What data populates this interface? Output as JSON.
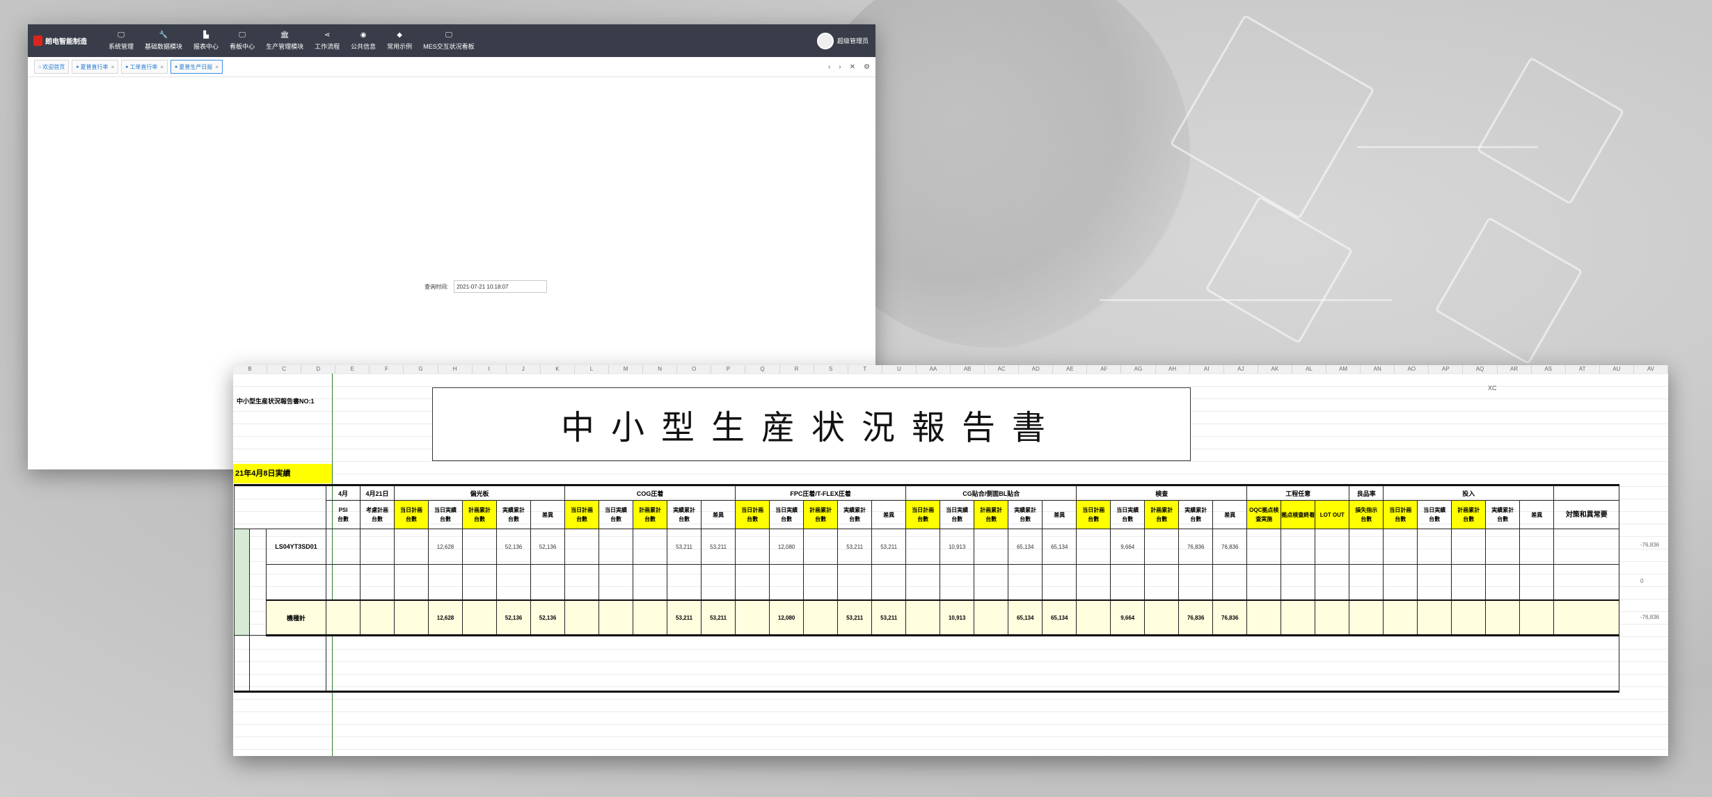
{
  "app": {
    "logo_text": "朗电智能制造",
    "nav": [
      {
        "icon": "monitor-icon",
        "glyph": "🖵",
        "label": "系统管理"
      },
      {
        "icon": "wrench-icon",
        "glyph": "🔧",
        "label": "基础数据模块"
      },
      {
        "icon": "chart-icon",
        "glyph": "▙",
        "label": "报表中心"
      },
      {
        "icon": "monitor-icon",
        "glyph": "🖵",
        "label": "看板中心"
      },
      {
        "icon": "bank-icon",
        "glyph": "🏛",
        "label": "生产管理模块"
      },
      {
        "icon": "share-icon",
        "glyph": "⋖",
        "label": "工作流程"
      },
      {
        "icon": "globe-icon",
        "glyph": "◉",
        "label": "公共信息"
      },
      {
        "icon": "tag-icon",
        "glyph": "◆",
        "label": "常用示例"
      },
      {
        "icon": "monitor-icon",
        "glyph": "🖵",
        "label": "MES交互状况看板"
      }
    ],
    "user_name": "超级管理员",
    "tabs": [
      {
        "label": "欢迎首页",
        "marker": "⌂",
        "closable": false,
        "active": false
      },
      {
        "label": "夏普直行率",
        "marker": "●",
        "closable": true,
        "active": false
      },
      {
        "label": "工单直行率",
        "marker": "●",
        "closable": true,
        "active": false
      },
      {
        "label": "夏普生产日报",
        "marker": "●",
        "closable": true,
        "active": true
      }
    ],
    "tab_tools": [
      "‹",
      "›",
      "✕",
      "⚙"
    ],
    "query_label": "查询时间:",
    "query_value": "2021-07-21 10:18:07"
  },
  "sheet": {
    "col_letters": [
      "B",
      "C",
      "D",
      "E",
      "F",
      "G",
      "H",
      "I",
      "J",
      "K",
      "L",
      "M",
      "N",
      "O",
      "P",
      "Q",
      "R",
      "S",
      "T",
      "U",
      "AA",
      "AB",
      "AC",
      "AD",
      "AE",
      "AF",
      "AG",
      "AH",
      "AI",
      "AJ",
      "AK",
      "AL",
      "AM",
      "AN",
      "AO",
      "AP",
      "AQ",
      "AR",
      "AS",
      "AT",
      "AU",
      "AV"
    ],
    "report_id": "中小型生産状況報告書NO:1",
    "title": "中小型生産状況報告書",
    "date_label": "21年4月8日実績",
    "xc": "XC",
    "group_headers": [
      "4月",
      "4月21日",
      "偏光板",
      "COG圧着",
      "FPC圧着/T-FLEX圧着",
      "CG貼合/側面BL貼合",
      "検査",
      "工程任意",
      "良品率",
      "投入"
    ],
    "sub_headers": [
      "PSI\n台數",
      "考慮計画\n台數",
      "当日計画\n台數",
      "当日実績\n台數",
      "計画累計\n台數",
      "実績累計\n台數",
      "差異",
      "当日計画\n台數",
      "当日実績\n台數",
      "計画累計\n台數",
      "実績累計\n台數",
      "差異",
      "当日計画\n台數",
      "当日実績\n台數",
      "計画累計\n台數",
      "実績累計\n台數",
      "差異",
      "当日計画\n台數",
      "当日実績\n台數",
      "計画累計\n台數",
      "実績累計\n台數",
      "差異",
      "当日計画\n台數",
      "当日実績\n台數",
      "計画累計\n台數",
      "実績累計\n台數",
      "差異",
      "OQC拠点検\n査実施",
      "拠点検査終着",
      "LOT OUT",
      "損失指示\n台數",
      "当日計画\n台數",
      "当日実績\n台數",
      "計画累計\n台數",
      "実績累計\n台數",
      "差異"
    ],
    "remark_header": "対策和異常要",
    "model": "LS04YT3SD01",
    "subtotal_label": "機種計",
    "row1": {
      "pol": [
        "",
        "12,628",
        "",
        "52,136",
        "52,136"
      ],
      "cog": [
        "",
        "",
        "",
        "53,211",
        "53,211"
      ],
      "fpc": [
        "",
        "12,080",
        "",
        "53,211",
        "53,211"
      ],
      "cg": [
        "",
        "10,913",
        "",
        "65,134",
        "65,134"
      ],
      "insp": [
        "",
        "9,664",
        "",
        "76,836",
        "76,836"
      ]
    },
    "totals": {
      "pol": [
        "",
        "12,628",
        "",
        "52,136",
        "52,136"
      ],
      "cog": [
        "",
        "",
        "",
        "53,211",
        "53,211"
      ],
      "fpc": [
        "",
        "12,080",
        "",
        "53,211",
        "53,211"
      ],
      "cg": [
        "",
        "10,913",
        "",
        "65,134",
        "65,134"
      ],
      "insp": [
        "",
        "9,664",
        "",
        "76,836",
        "76,836"
      ]
    },
    "side_values": [
      "-76,836",
      "0",
      "-76,836"
    ]
  }
}
